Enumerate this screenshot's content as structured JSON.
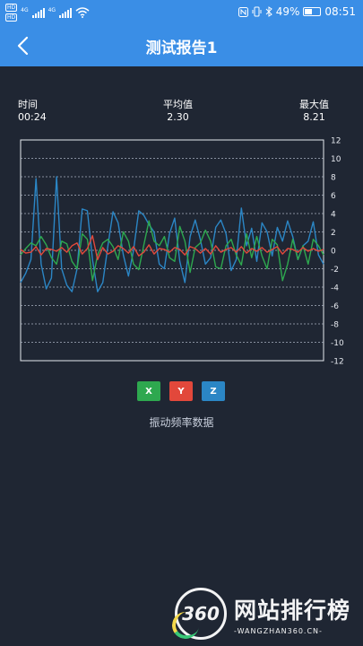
{
  "status_bar": {
    "hd1": "HD",
    "hd2": "HD",
    "net1": "4G",
    "net2": "4G",
    "battery_text": "49%",
    "battery_level": 0.49,
    "time": "08:51",
    "icons": [
      "nfc-icon",
      "bluetooth-icon",
      "vibrate-icon",
      "wifi-icon",
      "signal-icon"
    ]
  },
  "nav": {
    "title": "测试报告1",
    "back_icon": "chevron-left-icon"
  },
  "stats": {
    "time_label": "时间",
    "time_value": "00:24",
    "avg_label": "平均值",
    "avg_value": "2.30",
    "max_label": "最大值",
    "max_value": "8.21"
  },
  "chart_data": {
    "type": "line",
    "title": "振动频率数据",
    "xlabel": "",
    "ylabel": "",
    "ylim": [
      -12,
      12
    ],
    "yticks": [
      12,
      10,
      8,
      6,
      4,
      2,
      0,
      -2,
      -4,
      -6,
      -8,
      -10,
      -12
    ],
    "grid": true,
    "series": [
      {
        "name": "X",
        "color": "#2ea84f",
        "values": [
          -0.5,
          0.2,
          0.8,
          0.5,
          1.5,
          0.6,
          -0.8,
          -1.5,
          1.0,
          0.7,
          -1.2,
          -2.0,
          1.8,
          1.2,
          -3.3,
          -0.5,
          0.8,
          1.2,
          0.4,
          -1.0,
          2.0,
          1.0,
          -1.5,
          -2.1,
          0.6,
          3.2,
          1.0,
          0.5,
          1.5,
          -0.8,
          -1.2,
          2.6,
          1.0,
          -2.4,
          0.3,
          0.8,
          2.2,
          1.0,
          -1.8,
          -2.0,
          0.5,
          1.2,
          -0.5,
          -1.6,
          1.8,
          -0.8,
          1.5,
          -0.6,
          -2.0,
          1.2,
          0.6,
          -3.3,
          -1.5,
          1.2,
          -1.0,
          0.5,
          -1.5,
          1.2,
          0.5,
          -0.5
        ]
      },
      {
        "name": "Y",
        "color": "#e2483b",
        "values": [
          0.1,
          -0.3,
          -0.2,
          0.4,
          -0.5,
          0.2,
          0.1,
          -0.1,
          0.3,
          -0.2,
          0.5,
          0.8,
          -0.4,
          0.2,
          1.6,
          -1.0,
          0.3,
          -0.4,
          -0.1,
          0.5,
          0.2,
          -0.3,
          0.4,
          -0.6,
          -0.2,
          0.6,
          -0.4,
          0.2,
          0.1,
          -0.2,
          0.3,
          0.1,
          -0.5,
          0.4,
          0.2,
          -0.3,
          0.2,
          -0.4,
          0.5,
          -0.2,
          0.1,
          0.3,
          -0.2,
          0.4,
          -0.3,
          0.2,
          -0.1,
          0.3,
          -0.2,
          0.1,
          0.4,
          -0.4,
          0.2,
          0.1,
          -0.2,
          0.3,
          -0.1,
          0.2,
          -0.1,
          0.1
        ]
      },
      {
        "name": "Z",
        "color": "#2b86c5",
        "values": [
          -3.5,
          -2.5,
          -1.0,
          7.8,
          -1.5,
          -4.2,
          -3.0,
          8.0,
          -2.0,
          -3.8,
          -4.5,
          -2.0,
          4.5,
          4.3,
          -1.0,
          -4.5,
          -3.5,
          0.5,
          4.2,
          3.0,
          -0.5,
          -2.8,
          0.0,
          4.3,
          3.8,
          2.8,
          2.0,
          -1.5,
          -2.0,
          1.8,
          3.5,
          -1.2,
          -3.5,
          1.5,
          3.3,
          1.2,
          -1.5,
          -0.8,
          2.5,
          3.3,
          1.8,
          -2.2,
          -1.0,
          4.6,
          0.5,
          2.4,
          -1.2,
          3.0,
          2.0,
          -0.6,
          2.5,
          1.0,
          3.2,
          1.5,
          -1.0,
          0.5,
          1.0,
          3.1,
          -0.5,
          -1.5
        ]
      }
    ]
  },
  "legend": {
    "x_label": "X",
    "y_label": "Y",
    "z_label": "Z",
    "x_color": "#2ea84f",
    "y_color": "#e2483b",
    "z_color": "#2b86c5"
  },
  "caption": "振动频率数据",
  "watermark": {
    "logo_text": "360",
    "title": "网站排行榜",
    "subtitle": "-WANGZHAN360.CN-"
  }
}
